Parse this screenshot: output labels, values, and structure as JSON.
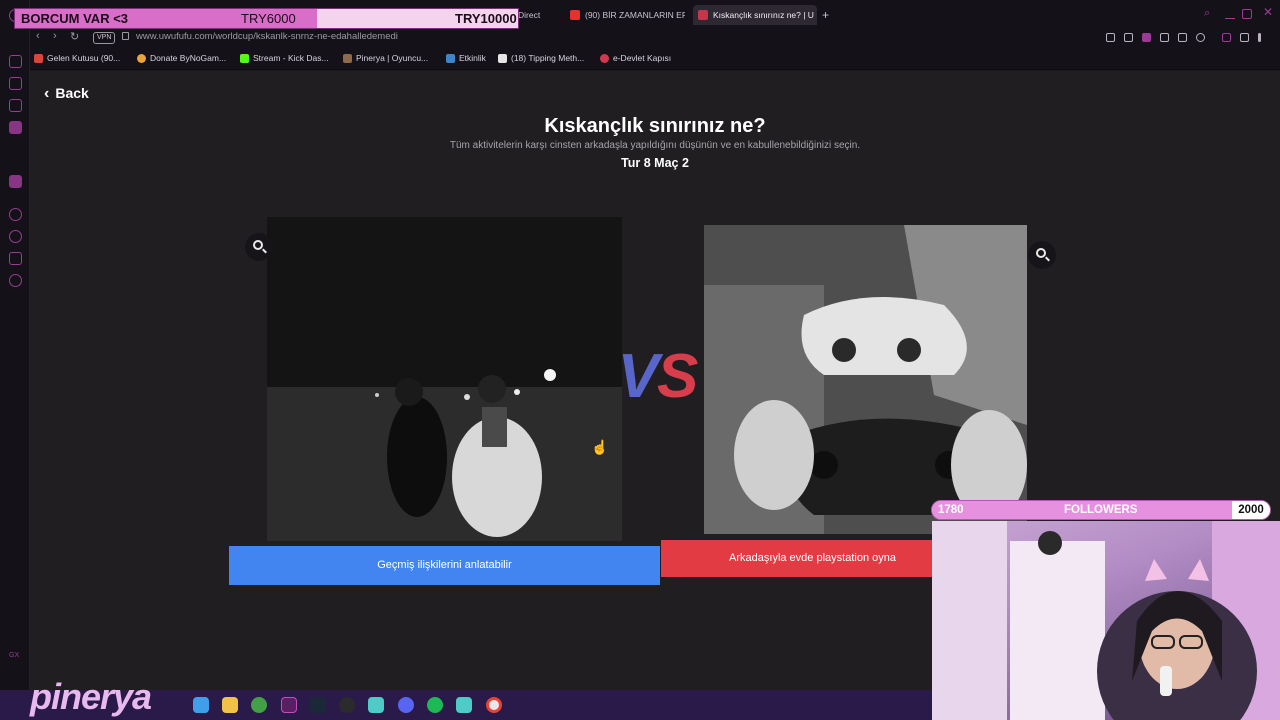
{
  "browser": {
    "tabs": [
      {
        "label": "Direct"
      },
      {
        "label": "(90) BİR ZAMANLARIN EF"
      },
      {
        "label": "Kıskançlık sınırınız ne? | U"
      }
    ],
    "address": {
      "vpn_label": "VPN",
      "url": "www.uwufufu.com/worldcup/kskanlk-snrnz-ne-edahalledemedi"
    },
    "bookmarks": [
      {
        "label": "Gelen Kutusu (90..."
      },
      {
        "label": "Donate ByNoGam..."
      },
      {
        "label": "Stream - Kick Das..."
      },
      {
        "label": "Pinerya | Oyuncu..."
      },
      {
        "label": "Etkinlik"
      },
      {
        "label": "(18) Tipping Meth..."
      },
      {
        "label": "e-Devlet Kapısı"
      }
    ]
  },
  "page": {
    "back_label": "Back",
    "title": "Kıskançlık sınırınız ne?",
    "subtitle": "Tüm aktivitelerin karşı cinsten arkadaşla yapıldığını düşünün ve en kabullenebildiğinizi seçin.",
    "round": "Tur 8 Maç 2",
    "vs_v": "V",
    "vs_s": "S",
    "left_choice": "Geçmiş ilişkilerini anlatabilir",
    "right_choice": "Arkadaşıyla evde playstation oyna"
  },
  "overlay": {
    "donation": {
      "label": "BORCUM VAR <3",
      "current": "TRY6000",
      "goal": "TRY10000",
      "progress": 0.6
    },
    "followers": {
      "current": "1780",
      "label": "FOLLOWERS",
      "goal": "2000",
      "progress": 0.89
    },
    "brand": "pinerya",
    "gx_label": "GX"
  },
  "colors": {
    "accent": "#9b3b95",
    "left_button": "#4285f0",
    "right_button": "#e23b44",
    "vs_blue": "#5866c9",
    "vs_red": "#d83d4c"
  }
}
